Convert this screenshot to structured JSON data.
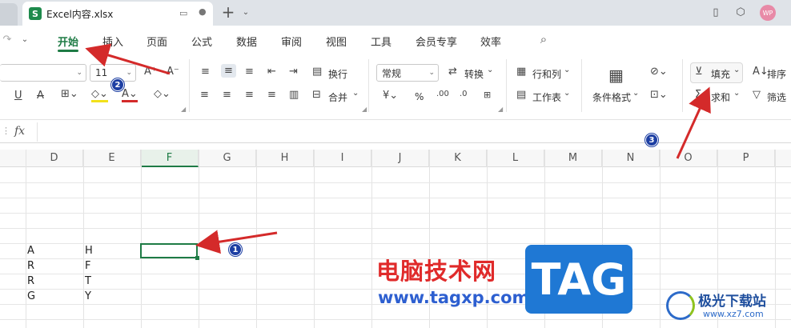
{
  "app_icon_letter": "S",
  "document_tab": "Excel内容.xlsx",
  "menu": [
    "开始",
    "插入",
    "页面",
    "公式",
    "数据",
    "审阅",
    "视图",
    "工具",
    "会员专享",
    "效率"
  ],
  "avatar_text": "WP",
  "ribbon": {
    "font_size": "11",
    "wrap_text": "换行",
    "merge": "合并",
    "number_format": "常规",
    "convert": "转换",
    "rows_cols": "行和列",
    "worksheet": "工作表",
    "conditional_format": "条件格式",
    "fill": "填充",
    "sort": "排序",
    "sum": "求和",
    "filter": "筛选",
    "percent": "%"
  },
  "formula_bar": {
    "fx_label": "fx"
  },
  "grid": {
    "columns": [
      "D",
      "E",
      "F",
      "G",
      "H",
      "I",
      "J",
      "K",
      "L",
      "M",
      "N",
      "O",
      "P"
    ],
    "selected_column": "F",
    "col_d_values": [
      "A",
      "R",
      "R",
      "G"
    ],
    "col_e_values": [
      "H",
      "F",
      "T",
      "Y"
    ]
  },
  "annotations": {
    "badge1": "1",
    "badge2": "2",
    "badge3": "3"
  },
  "watermarks": {
    "site_cn": "电脑技术网",
    "site_url": "www.tagxp.com",
    "tag_logo": "TAG",
    "xz_name": "极光下载站",
    "xz_url": "www.xz7.com"
  },
  "colors": {
    "accent_green": "#1e7b45",
    "arrow_red": "#d42a2a",
    "badge_blue": "#1d3fa3"
  }
}
